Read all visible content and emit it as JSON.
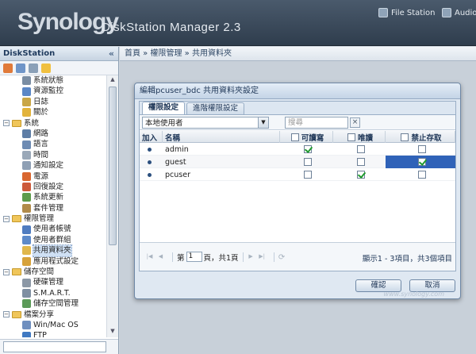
{
  "app": {
    "brand": "Synology",
    "product": "DiskStation Manager 2.3",
    "header_links": [
      {
        "label": "File Station",
        "icon": "file-station-icon"
      },
      {
        "label": "Audio S",
        "icon": "audio-station-icon"
      }
    ]
  },
  "sidebar": {
    "title": "DiskStation",
    "collapse_glyph": "«",
    "groups": [
      {
        "label": "",
        "expanded": true,
        "items": [
          {
            "label": "系統狀態",
            "icon": "system-status-icon",
            "color": "#7a8da3"
          },
          {
            "label": "資源監控",
            "icon": "resource-monitor-icon",
            "color": "#5b87c6"
          },
          {
            "label": "日誌",
            "icon": "log-icon",
            "color": "#c9a646"
          },
          {
            "label": "關於",
            "icon": "info-icon",
            "color": "#e2b33b"
          }
        ]
      },
      {
        "label": "系統",
        "expanded": true,
        "items": [
          {
            "label": "網路",
            "icon": "network-icon",
            "color": "#5e7ea6"
          },
          {
            "label": "語言",
            "icon": "language-icon",
            "color": "#6d8bb3"
          },
          {
            "label": "時間",
            "icon": "clock-icon",
            "color": "#9aa8b8"
          },
          {
            "label": "通知設定",
            "icon": "notification-icon",
            "color": "#8fa0b5"
          },
          {
            "label": "電源",
            "icon": "power-icon",
            "color": "#d9662f"
          },
          {
            "label": "回復設定",
            "icon": "restore-icon",
            "color": "#cc5a3b"
          },
          {
            "label": "系統更新",
            "icon": "update-icon",
            "color": "#5d9b4b"
          },
          {
            "label": "套件管理",
            "icon": "package-icon",
            "color": "#b18b4a"
          }
        ]
      },
      {
        "label": "權限管理",
        "expanded": true,
        "items": [
          {
            "label": "使用者帳號",
            "icon": "user-icon",
            "color": "#4f7cc0"
          },
          {
            "label": "使用者群組",
            "icon": "group-icon",
            "color": "#5d8ac9"
          },
          {
            "label": "共用資料夾",
            "icon": "shared-folder-icon",
            "color": "#e0b74c",
            "selected": true
          },
          {
            "label": "應用程式設定",
            "icon": "app-settings-icon",
            "color": "#d7a23a"
          }
        ]
      },
      {
        "label": "儲存空間",
        "expanded": true,
        "items": [
          {
            "label": "硬碟管理",
            "icon": "disk-icon",
            "color": "#8c98a6"
          },
          {
            "label": "S.M.A.R.T.",
            "icon": "smart-icon",
            "color": "#7f8fa2"
          },
          {
            "label": "儲存空間管理",
            "icon": "storage-icon",
            "color": "#5b9a58"
          }
        ]
      },
      {
        "label": "檔案分享",
        "expanded": true,
        "items": [
          {
            "label": "Win/Mac OS",
            "icon": "win-mac-icon",
            "color": "#6f8fbf"
          },
          {
            "label": "FTP",
            "icon": "ftp-icon",
            "color": "#3f79c2"
          }
        ]
      }
    ]
  },
  "breadcrumb": "首頁 » 權限管理 » 共用資料夾",
  "dialog": {
    "title": "編輯pcuser_bdc 共用資料夾設定",
    "tabs": [
      {
        "label": "權限設定",
        "active": true
      },
      {
        "label": "進階權限設定",
        "active": false
      }
    ],
    "user_source": "本地使用者",
    "search_placeholder": "搜尋",
    "columns": [
      "加入",
      "名稱",
      "可讀寫",
      "唯讀",
      "禁止存取"
    ],
    "rows": [
      {
        "name": "admin",
        "rw": true,
        "ro": false,
        "deny": false
      },
      {
        "name": "guest",
        "rw": false,
        "ro": false,
        "deny": true
      },
      {
        "name": "pcuser",
        "rw": false,
        "ro": true,
        "deny": false
      }
    ],
    "pager": {
      "page_prefix": "第",
      "page_value": "1",
      "page_suffix": "頁，共1頁",
      "info": "顯示1 - 3項目，共3個項目"
    },
    "buttons": {
      "ok": "確認",
      "cancel": "取消"
    },
    "watermark": "www.synology.com"
  },
  "colors": {
    "accent": "#2f62b8",
    "check": "#1f9a2e",
    "header": "#3b4a5b"
  }
}
